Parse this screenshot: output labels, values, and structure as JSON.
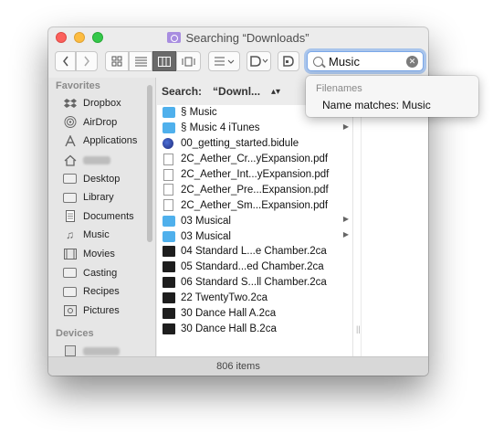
{
  "window": {
    "title": "Searching “Downloads”"
  },
  "toolbar": {
    "search_value": "Music",
    "clear_glyph": "✕"
  },
  "sidebar": {
    "favorites_label": "Favorites",
    "items": [
      {
        "label": "Dropbox",
        "icon": "dropbox-icon"
      },
      {
        "label": "AirDrop",
        "icon": "airdrop-icon"
      },
      {
        "label": "Applications",
        "icon": "applications-icon"
      },
      {
        "label": "",
        "icon": "home-icon"
      },
      {
        "label": "Desktop",
        "icon": "desktop-icon"
      },
      {
        "label": "Library",
        "icon": "folder-icon"
      },
      {
        "label": "Documents",
        "icon": "documents-icon"
      },
      {
        "label": "Music",
        "icon": "music-icon"
      },
      {
        "label": "Movies",
        "icon": "movies-icon"
      },
      {
        "label": "Casting",
        "icon": "folder-icon"
      },
      {
        "label": "Recipes",
        "icon": "folder-icon"
      },
      {
        "label": "Pictures",
        "icon": "pictures-icon"
      }
    ],
    "devices_label": "Devices"
  },
  "searchbar": {
    "label": "Search:",
    "scope": "“Downl...",
    "chevron": "⌃"
  },
  "files": [
    {
      "name": "§ Music",
      "kind": "folder",
      "has_children": false
    },
    {
      "name": "§ Music 4 iTunes",
      "kind": "folder",
      "has_children": true
    },
    {
      "name": "00_getting_started.bidule",
      "kind": "bidule",
      "has_children": false
    },
    {
      "name": "2C_Aether_Cr...yExpansion.pdf",
      "kind": "pdf",
      "has_children": false
    },
    {
      "name": "2C_Aether_Int...yExpansion.pdf",
      "kind": "pdf",
      "has_children": false
    },
    {
      "name": "2C_Aether_Pre...Expansion.pdf",
      "kind": "pdf",
      "has_children": false
    },
    {
      "name": "2C_Aether_Sm...Expansion.pdf",
      "kind": "pdf",
      "has_children": false
    },
    {
      "name": "03 Musical",
      "kind": "folder",
      "has_children": true
    },
    {
      "name": "03 Musical",
      "kind": "folder",
      "has_children": true
    },
    {
      "name": "04 Standard L...e Chamber.2ca",
      "kind": "dark",
      "has_children": false
    },
    {
      "name": "05 Standard...ed Chamber.2ca",
      "kind": "dark",
      "has_children": false
    },
    {
      "name": "06 Standard S...ll Chamber.2ca",
      "kind": "dark",
      "has_children": false
    },
    {
      "name": "22 TwentyTwo.2ca",
      "kind": "dark",
      "has_children": false
    },
    {
      "name": "30 Dance Hall A.2ca",
      "kind": "dark",
      "has_children": false
    },
    {
      "name": "30 Dance Hall B.2ca",
      "kind": "dark",
      "has_children": false
    }
  ],
  "status": {
    "text": "806 items"
  },
  "dropdown": {
    "header": "Filenames",
    "item": "Name matches: Music"
  }
}
